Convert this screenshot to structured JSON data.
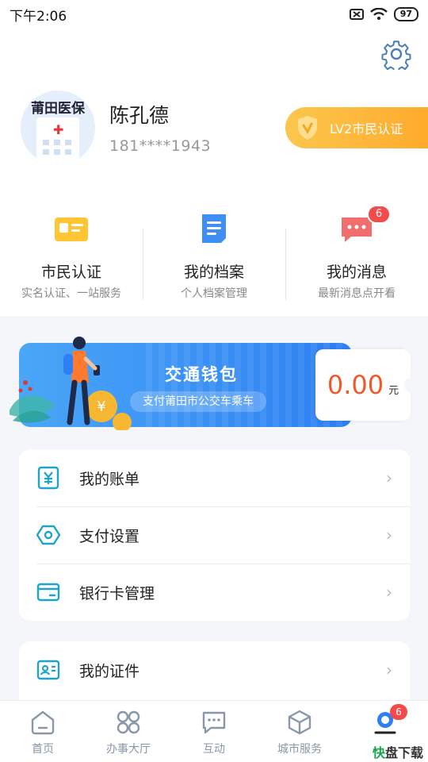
{
  "status_bar": {
    "time": "下午2:06",
    "battery": "97"
  },
  "profile": {
    "avatar_text": "莆田医保",
    "name": "陈孔德",
    "phone": "181****1943",
    "level_badge": "LV2市民认证"
  },
  "quick_actions": [
    {
      "title": "市民认证",
      "subtitle": "实名认证、一站服务"
    },
    {
      "title": "我的档案",
      "subtitle": "个人档案管理"
    },
    {
      "title": "我的消息",
      "subtitle": "最新消息点开看",
      "badge": "6"
    }
  ],
  "wallet": {
    "title": "交通钱包",
    "subtitle": "支付莆田市公交车乘车",
    "amount": "0.00",
    "unit": "元"
  },
  "menu": [
    {
      "label": "我的账单"
    },
    {
      "label": "支付设置"
    },
    {
      "label": "银行卡管理"
    }
  ],
  "menu2": [
    {
      "label": "我的证件"
    }
  ],
  "tabs": [
    {
      "label": "首页"
    },
    {
      "label": "办事大厅"
    },
    {
      "label": "互动"
    },
    {
      "label": "城市服务"
    },
    {
      "label": "",
      "badge": "6"
    }
  ],
  "watermark": {
    "brand_a": "快",
    "brand_b": "盘下载"
  },
  "colors": {
    "accent_blue": "#2d7ff3",
    "badge_red": "#f14b4b",
    "amount_orange": "#f05a2a",
    "level_yellow": "#ffab2c",
    "menu_icon": "#1ea3c9"
  }
}
